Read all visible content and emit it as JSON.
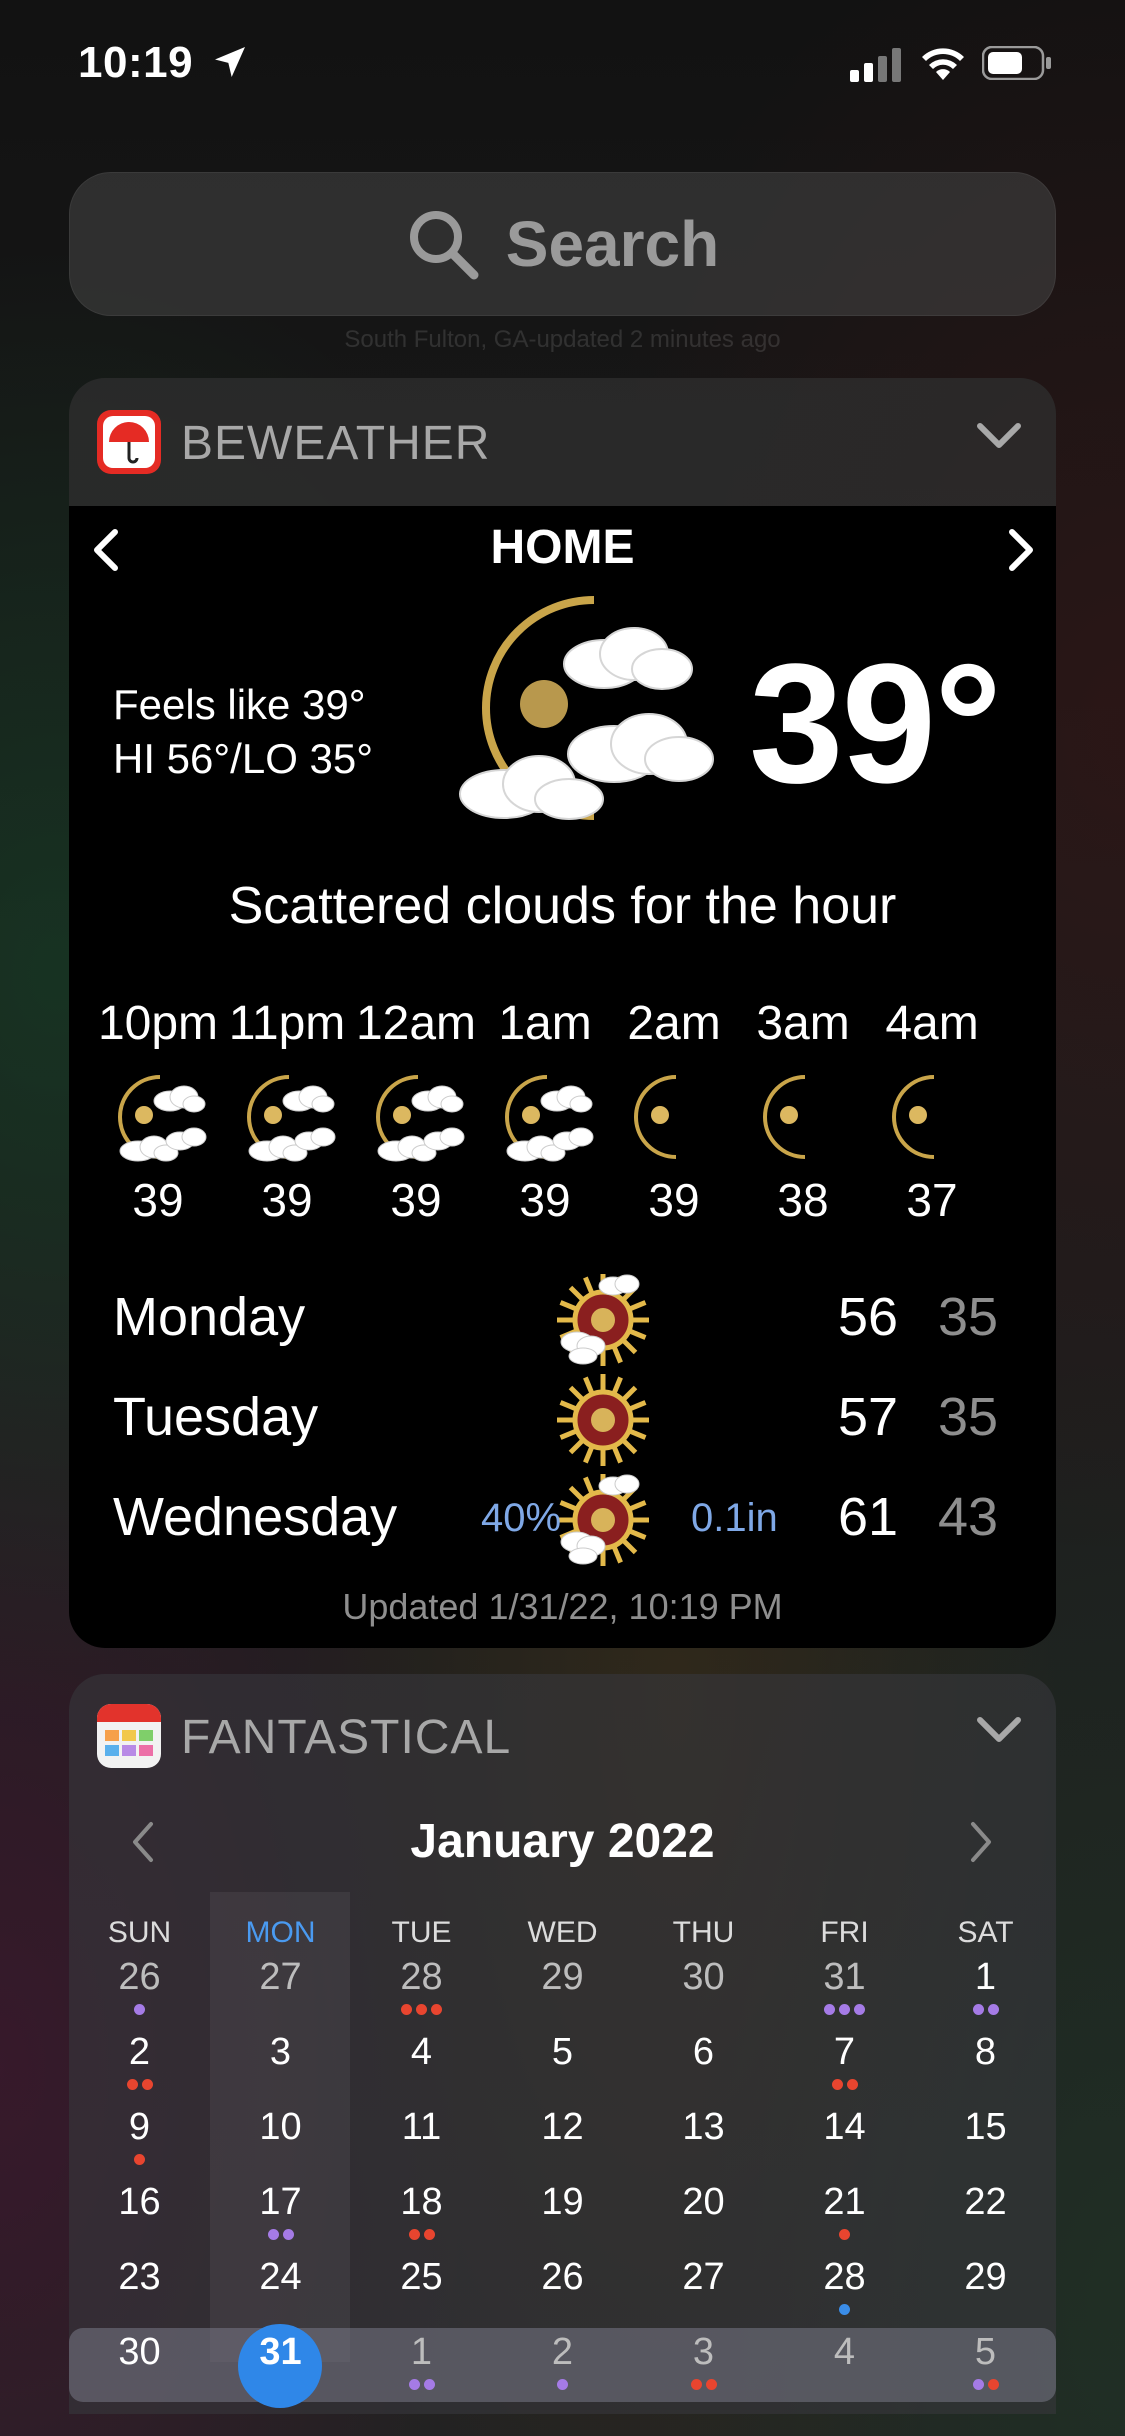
{
  "status_bar": {
    "time": "10:19",
    "icons": [
      "location-arrow-icon",
      "cellular-signal-icon",
      "wifi-icon",
      "battery-icon"
    ]
  },
  "search": {
    "placeholder": "Search"
  },
  "faint_text": "South Fulton, GA-updated 2 minutes ago",
  "beweather": {
    "app_name": "BEWEATHER",
    "location": "HOME",
    "feels_like": "Feels like 39°",
    "hi_lo": "HI 56°/LO 35°",
    "current_temp": "39°",
    "summary": "Scattered clouds for the hour",
    "hourly": [
      {
        "time": "10pm",
        "temp": "39",
        "icon": "moon-clouds"
      },
      {
        "time": "11pm",
        "temp": "39",
        "icon": "moon-clouds"
      },
      {
        "time": "12am",
        "temp": "39",
        "icon": "moon-clouds"
      },
      {
        "time": "1am",
        "temp": "39",
        "icon": "moon-clouds"
      },
      {
        "time": "2am",
        "temp": "39",
        "icon": "moon"
      },
      {
        "time": "3am",
        "temp": "38",
        "icon": "moon"
      },
      {
        "time": "4am",
        "temp": "37",
        "icon": "moon"
      }
    ],
    "daily": [
      {
        "day": "Monday",
        "hi": "56",
        "lo": "35",
        "precip_chance": "",
        "precip_amount": "",
        "icon": "sun-clouds"
      },
      {
        "day": "Tuesday",
        "hi": "57",
        "lo": "35",
        "precip_chance": "",
        "precip_amount": "",
        "icon": "sun"
      },
      {
        "day": "Wednesday",
        "hi": "61",
        "lo": "43",
        "precip_chance": "40%",
        "precip_amount": "0.1in",
        "icon": "sun-clouds"
      }
    ],
    "updated": "Updated 1/31/22, 10:19 PM"
  },
  "fantastical": {
    "app_name": "FANTASTICAL",
    "month": "January 2022",
    "weekdays": [
      "SUN",
      "MON",
      "TUE",
      "WED",
      "THU",
      "FRI",
      "SAT"
    ],
    "current_weekday": "MON",
    "today": "31",
    "weeks": [
      [
        "26",
        "27",
        "28",
        "29",
        "30",
        "31",
        "1"
      ],
      [
        "2",
        "3",
        "4",
        "5",
        "6",
        "7",
        "8"
      ],
      [
        "9",
        "10",
        "11",
        "12",
        "13",
        "14",
        "15"
      ],
      [
        "16",
        "17",
        "18",
        "19",
        "20",
        "21",
        "22"
      ],
      [
        "23",
        "24",
        "25",
        "26",
        "27",
        "28",
        "29"
      ],
      [
        "30",
        "31",
        "1",
        "2",
        "3",
        "4",
        "5"
      ]
    ],
    "colors": {
      "today": "#2f87e8",
      "weekday_highlight": "#4a9af0",
      "dot_purple": "#a57be6",
      "dot_red": "#e8452f",
      "dot_blue": "#3a8de8"
    }
  }
}
